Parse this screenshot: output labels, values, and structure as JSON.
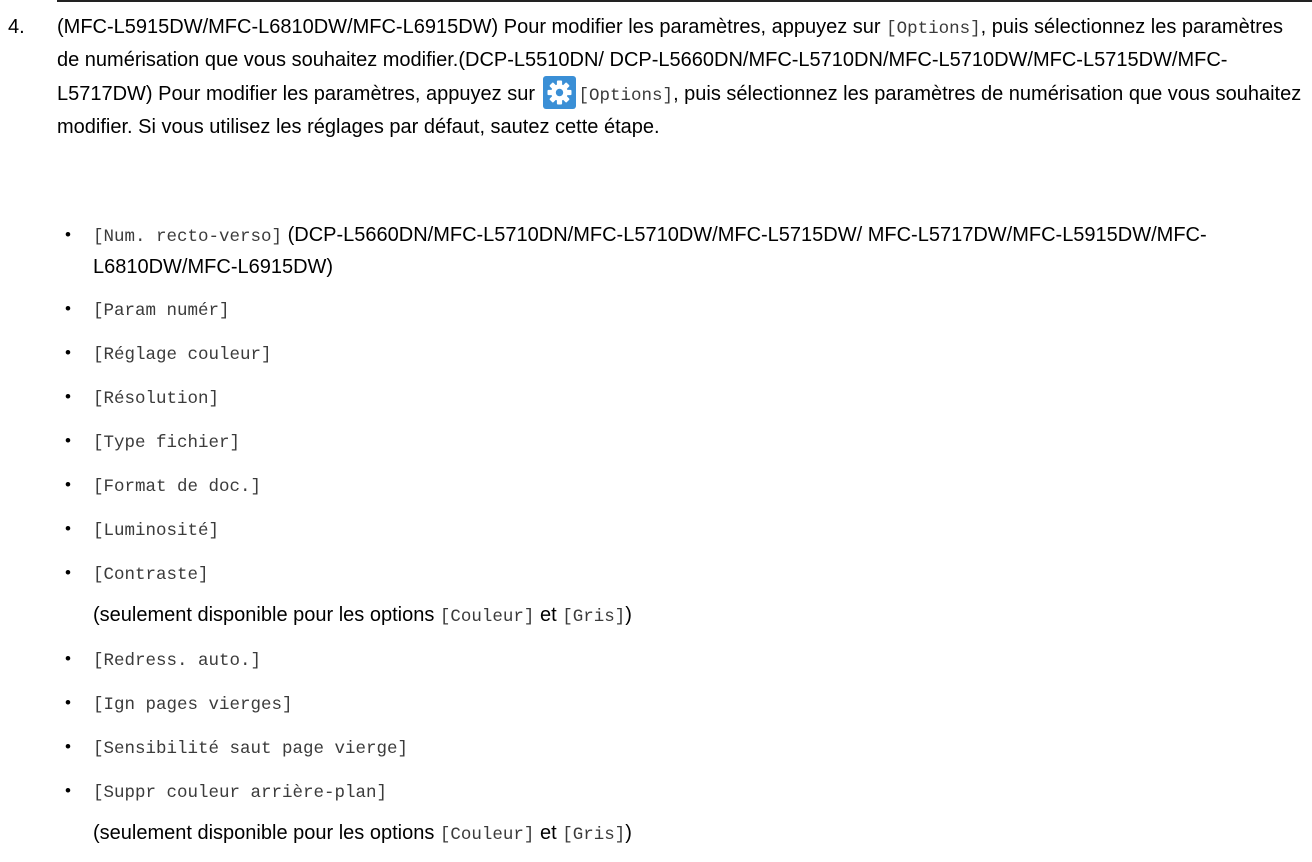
{
  "step": {
    "number": "4.",
    "text_1": "(MFC-L5915DW/MFC-L6810DW/MFC-L6915DW) Pour modifier les paramètres, appuyez sur ",
    "code_1": "[Options]",
    "text_2": ", puis sélectionnez les paramètres de numérisation que vous souhaitez modifier.(DCP-L5510DN/ DCP-L5660DN/MFC-L5710DN/MFC-L5710DW/MFC-L5715DW/MFC-L5717DW) Pour modifier les paramètres, appuyez sur ",
    "icon": "gear-icon",
    "code_2": "[Options]",
    "text_3": ", puis sélectionnez les paramètres de numérisation que vous souhaitez modifier. Si vous utilisez les réglages par défaut, sautez cette étape."
  },
  "options": {
    "num_recto_verso": "[Num. recto-verso]",
    "num_recto_verso_models": " (DCP-L5660DN/MFC-L5710DN/MFC-L5710DW/MFC-L5715DW/ MFC-L5717DW/MFC-L5915DW/MFC-L6810DW/MFC-L6915DW)",
    "param_numer": "[Param numér]",
    "reglage_couleur": "[Réglage couleur]",
    "resolution": "[Résolution]",
    "type_fichier": "[Type fichier]",
    "format_doc": "[Format de doc.]",
    "luminosite": "[Luminosité]",
    "contraste": "[Contraste]",
    "redress_auto": "[Redress. auto.]",
    "ign_pages_vierges": "[Ign pages vierges]",
    "sensibilite": "[Sensibilité saut page vierge]",
    "suppr_couleur": "[Suppr couleur arrière-plan]"
  },
  "note": {
    "prefix": "(seulement disponible pour les options ",
    "couleur": "[Couleur]",
    "joiner": " et ",
    "gris": "[Gris]",
    "suffix": ")"
  },
  "colors": {
    "gear_background": "#3a8fd6",
    "gear_foreground": "#ffffff"
  }
}
